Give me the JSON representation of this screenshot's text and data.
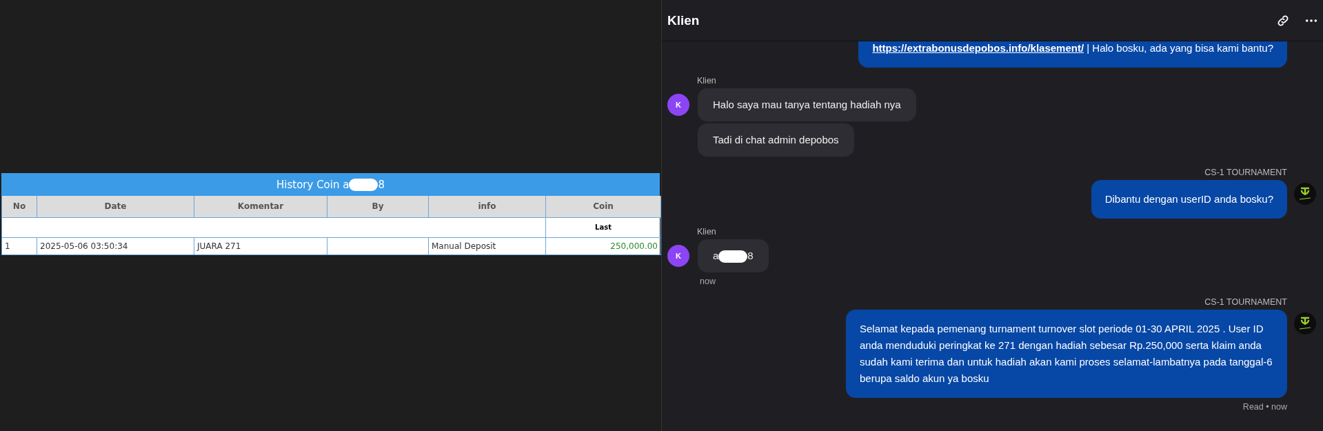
{
  "history_table": {
    "title_parts": [
      "History Coin a",
      "8"
    ],
    "redacted": true,
    "columns": [
      "No",
      "Date",
      "Komentar",
      "By",
      "info",
      "Coin"
    ],
    "subheader": "Last",
    "rows": [
      {
        "cells": [
          "1",
          "2025-05-06 03:50:34",
          "JUARA 271",
          "",
          "Manual Deposit",
          "250,000.00"
        ]
      }
    ]
  },
  "chat": {
    "title": "Klien",
    "messages": [
      {
        "kind": "agent",
        "link": "https://extrabonusdepobos.info/klasement/",
        "parts": [
          " | Halo bosku, ada yang bisa kami bantu?"
        ]
      },
      {
        "kind": "client",
        "sender": "Klien",
        "avatar": "K",
        "bubbles": [
          [
            "Halo saya mau tanya tentang hadiah nya"
          ],
          [
            "Tadi di chat admin depobos"
          ]
        ]
      },
      {
        "kind": "agent",
        "sender": "CS-1 TOURNAMENT",
        "parts": [
          "Dibantu dengan userID anda bosku?"
        ]
      },
      {
        "kind": "client",
        "sender": "Klien",
        "avatar": "K",
        "bubbles": [
          [
            "a",
            "8"
          ]
        ],
        "redacted": true,
        "time": "now"
      },
      {
        "kind": "agent",
        "sender": "CS-1 TOURNAMENT",
        "parts": [
          "Selamat kepada pemenang turnament turnover slot periode 01-30 APRIL 2025 . User ID anda menduduki peringkat ke 271 dengan hadiah sebesar Rp.250,000 serta klaim anda sudah kami terima dan untuk hadiah akan kami proses selamat-lambatnya pada tanggal-6 berupa saldo akun ya bosku"
        ],
        "status": "Read",
        "separator": "•",
        "time": "now"
      }
    ]
  }
}
